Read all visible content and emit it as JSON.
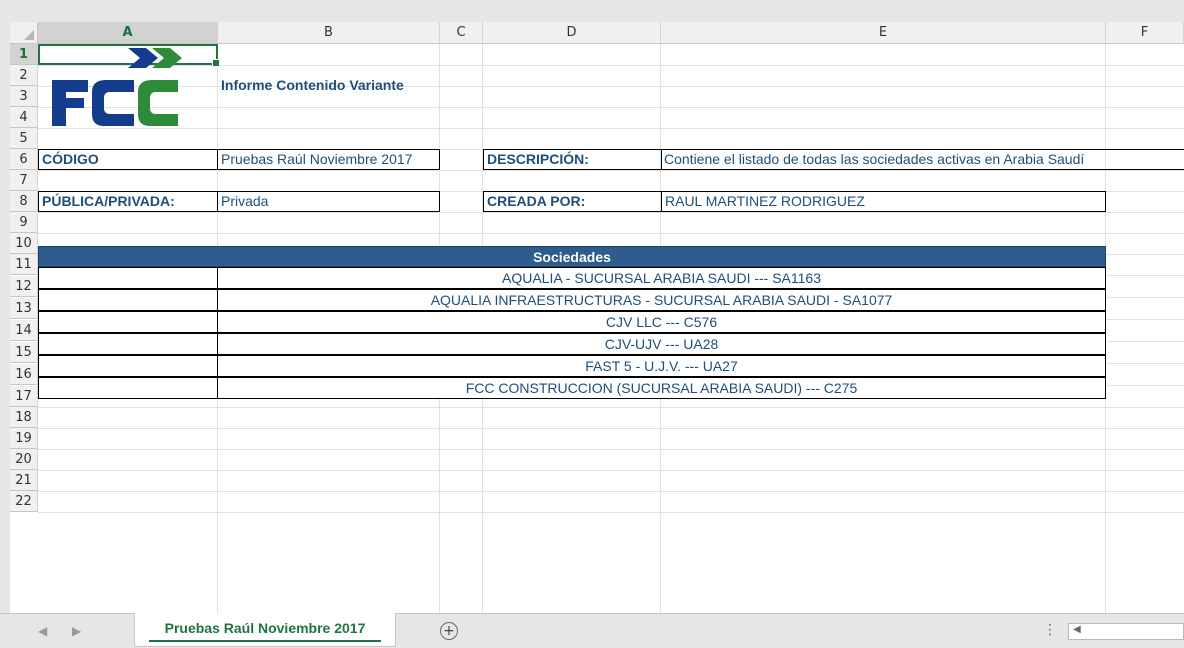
{
  "columns": [
    "A",
    "B",
    "C",
    "D",
    "E",
    "F"
  ],
  "selected_column": "A",
  "rows": [
    "1",
    "2",
    "3",
    "4",
    "5",
    "6",
    "7",
    "8",
    "9",
    "10",
    "11",
    "12",
    "13",
    "14",
    "15",
    "16",
    "17",
    "18",
    "19",
    "20",
    "21",
    "22"
  ],
  "selected_row": "1",
  "report": {
    "title": "Informe Contenido Variante",
    "codigo_label": "CÓDIGO",
    "codigo_value": "Pruebas Raúl Noviembre 2017",
    "descripcion_label": "DESCRIPCIÓN:",
    "descripcion_value": "Contiene el listado de todas las sociedades activas en Arabia Saudí",
    "publica_label": "PÚBLICA/PRIVADA:",
    "publica_value": "Privada",
    "creada_label": "CREADA POR:",
    "creada_value": "RAUL MARTINEZ RODRIGUEZ"
  },
  "logo": {
    "text": "FCC",
    "colors": {
      "blue": "#143c8c",
      "green": "#2e8b3a"
    }
  },
  "sociedades": {
    "header": "Sociedades",
    "items": [
      "AQUALIA - SUCURSAL ARABIA SAUDI --- SA1163",
      "AQUALIA INFRAESTRUCTURAS - SUCURSAL ARABIA SAUDI - SA1077",
      "CJV LLC --- C576",
      "CJV-UJV --- UA28",
      "FAST 5 - U.J.V. --- UA27",
      "FCC CONSTRUCCION (SUCURSAL ARABIA SAUDI) --- C275"
    ]
  },
  "tabs": {
    "active": "Pruebas Raúl Noviembre 2017",
    "add_icon": "plus-circle-icon"
  },
  "colors": {
    "accent": "#217346",
    "banner": "#2e5c8c",
    "text": "#1f4e79"
  }
}
